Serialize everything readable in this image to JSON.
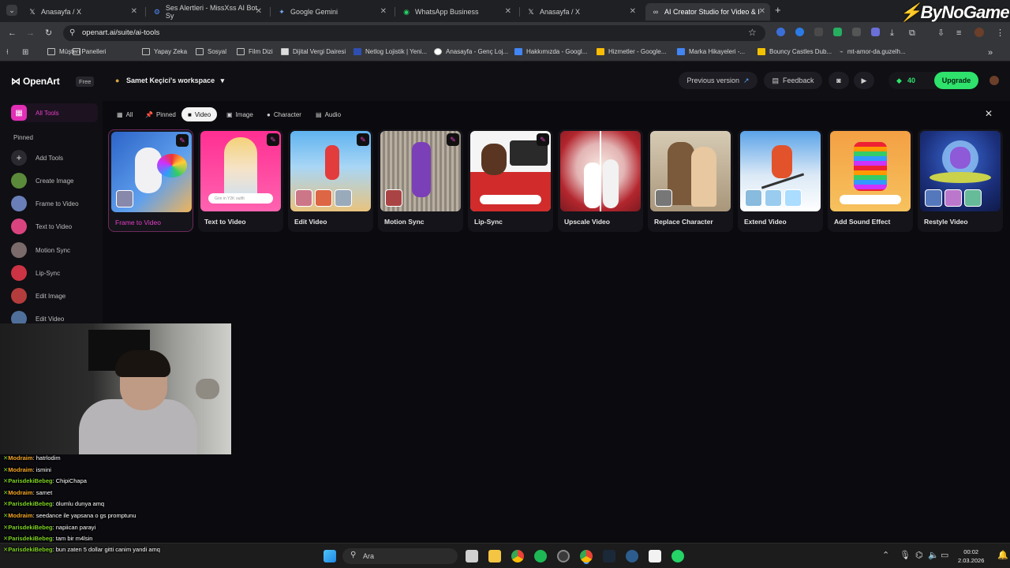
{
  "browser": {
    "tabs": [
      {
        "label": "Anasayfa / X",
        "icon": "x-logo-icon"
      },
      {
        "label": "Ses Alertleri - MissXss AI Bot Sy",
        "icon": "gear-icon"
      },
      {
        "label": "Google Gemini",
        "icon": "gemini-icon"
      },
      {
        "label": "WhatsApp Business",
        "icon": "whatsapp-icon"
      },
      {
        "label": "Anasayfa / X",
        "icon": "x-logo-icon"
      },
      {
        "label": "AI Creator Studio for Video & I",
        "icon": "openart-icon",
        "active": true
      }
    ],
    "url": "openart.ai/suite/ai-tools",
    "bookmarks": [
      "Müşteri Panelleri",
      "Yapay Zeka",
      "Sosyal",
      "Film Dizi",
      "Dijital Vergi Dairesi",
      "Netlog Lojistik | Yeni...",
      "Anasayfa - Genç Loj...",
      "Hakkımızda - Googl...",
      "Hizmetler - Google...",
      "Marka Hikayeleri -...",
      "Bouncy Castles Dub...",
      "mt-amor-da.guzelh..."
    ]
  },
  "app": {
    "logo": "OpenArt",
    "plan": "Free",
    "workspace": "Samet Keçici's workspace",
    "previous_version": "Previous version",
    "feedback": "Feedback",
    "credits": "40",
    "upgrade": "Upgrade"
  },
  "sidebar": {
    "all_tools": "All Tools",
    "pinned_heading": "Pinned",
    "items": [
      {
        "label": "Add Tools"
      },
      {
        "label": "Create Image"
      },
      {
        "label": "Frame to Video"
      },
      {
        "label": "Text to Video"
      },
      {
        "label": "Motion Sync"
      },
      {
        "label": "Lip-Sync"
      },
      {
        "label": "Edit Image"
      },
      {
        "label": "Edit Video"
      }
    ]
  },
  "filters": [
    {
      "label": "All"
    },
    {
      "label": "Pinned"
    },
    {
      "label": "Video",
      "active": true
    },
    {
      "label": "Image"
    },
    {
      "label": "Character"
    },
    {
      "label": "Audio"
    }
  ],
  "tools": [
    {
      "title": "Frame to Video",
      "selected": true
    },
    {
      "title": "Text to Video",
      "overlay": "Grin in Y2K outfit"
    },
    {
      "title": "Edit Video"
    },
    {
      "title": "Motion Sync"
    },
    {
      "title": "Lip-Sync"
    },
    {
      "title": "Upscale Video"
    },
    {
      "title": "Replace Character"
    },
    {
      "title": "Extend Video"
    },
    {
      "title": "Add Sound Effect"
    },
    {
      "title": "Restyle Video"
    }
  ],
  "chat": [
    {
      "user": "Modraim",
      "text": "hatrlodim",
      "color": "#f5a623"
    },
    {
      "user": "Modraim",
      "text": "ismini",
      "color": "#f5a623"
    },
    {
      "user": "ParisdekiBebeg",
      "text": "ChipiChapa",
      "color": "#7ed321"
    },
    {
      "user": "Modraim",
      "text": "samet",
      "color": "#f5a623"
    },
    {
      "user": "ParisdekiBebeg",
      "text": "ölumlu dunya amq",
      "color": "#7ed321"
    },
    {
      "user": "Modraim",
      "text": "seedance ile yapsana o gs promptunu",
      "color": "#f5a623"
    },
    {
      "user": "ParisdekiBebeg",
      "text": "napiican parayi",
      "color": "#7ed321"
    },
    {
      "user": "ParisdekiBebeg",
      "text": "tam bir m4lsin",
      "color": "#7ed321"
    },
    {
      "user": "ParisdekiBebeg",
      "text": "bun zaten 5 dollar gitti canim yandi amq",
      "color": "#7ed321"
    }
  ],
  "taskbar": {
    "search_placeholder": "Ara",
    "time": "00:02",
    "date": "2.03.2026"
  },
  "watermark": "ByNoGame",
  "colors": {
    "accent": "#e63fc7",
    "upgrade": "#2ee26b"
  }
}
